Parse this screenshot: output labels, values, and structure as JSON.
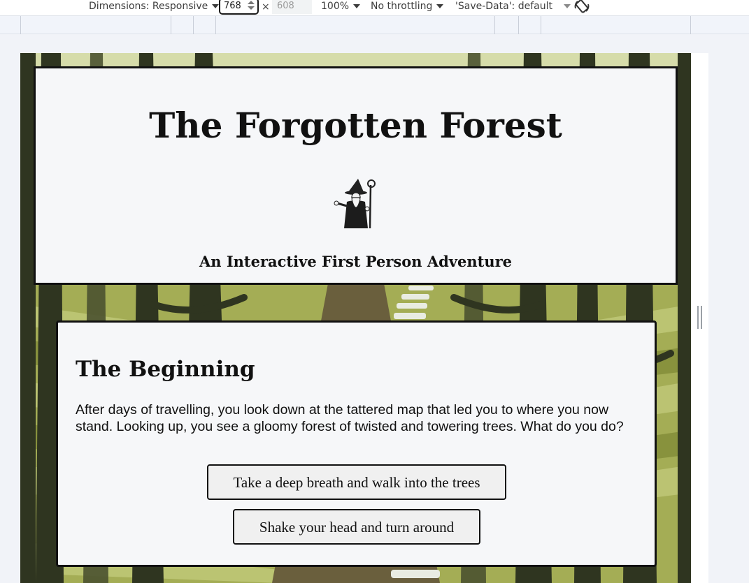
{
  "devtools": {
    "dimensions_label": "Dimensions: Responsive",
    "width_value": "768",
    "times_symbol": "×",
    "height_value": "608",
    "zoom": "100%",
    "throttling": "No throttling",
    "save_data": "'Save-Data': default"
  },
  "page": {
    "title": "The Forgotten Forest",
    "subtitle": "An Interactive First Person Adventure",
    "chapter": {
      "heading": "The Beginning",
      "text": "After days of travelling, you look down at the tattered map that led you to where you now stand. Looking up, you see a gloomy forest of twisted and towering trees. What do you do?",
      "choices": [
        {
          "label": "Take a deep breath and walk into the trees"
        },
        {
          "label": "Shake your head and turn around"
        }
      ]
    }
  },
  "colors": {
    "card_bg": "#f6f7f9",
    "border": "#111111",
    "forest_light": "#b4bd66",
    "forest_dark": "#2e321f"
  }
}
